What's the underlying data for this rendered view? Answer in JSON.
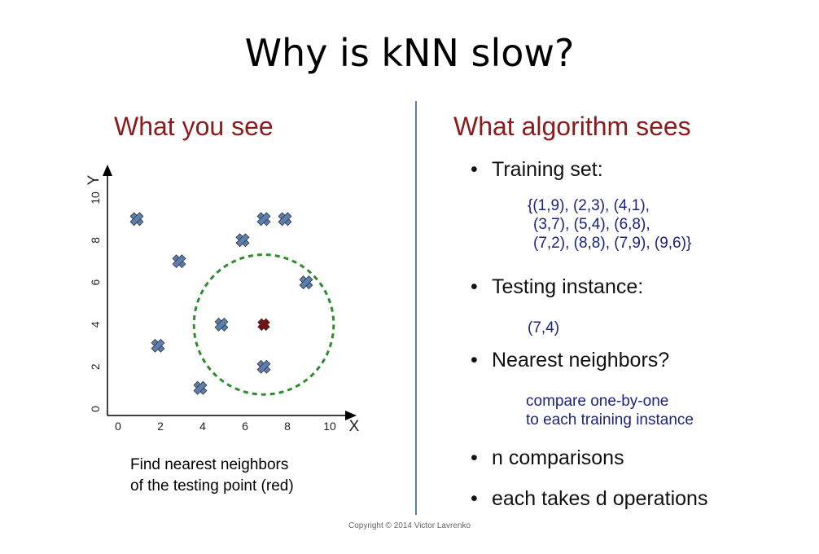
{
  "title": "Why is kNN slow?",
  "left": {
    "heading": "What you see",
    "caption_lines": [
      "Find nearest neighbors",
      "of the testing point (red)"
    ]
  },
  "right": {
    "heading": "What algorithm sees",
    "bullets": [
      "Training set:",
      "Testing instance:",
      "Nearest neighbors?",
      "n comparisons",
      "each takes d operations"
    ],
    "training_set_lines": [
      "{(1,9), (2,3), (4,1),",
      "(3,7), (5,4), (6,8),",
      "(7,2), (8,8), (7,9), (9,6)}"
    ],
    "testing_instance": "(7,4)",
    "nn_lines": [
      "compare one-by-one",
      "to each training instance"
    ]
  },
  "copyright": "Copyright © 2014 Victor Lavrenko",
  "colors": {
    "heading": "#8b1a1a",
    "training_point": "#5b7fb0",
    "test_point": "#7a0f0f",
    "circle": "#2e8b2e",
    "sub_text": "#1a237e"
  },
  "chart_data": {
    "type": "scatter",
    "xlabel": "X",
    "ylabel": "Y",
    "xlim": [
      0,
      10
    ],
    "ylim": [
      0,
      10
    ],
    "xticks": [
      "0",
      "2",
      "4",
      "6",
      "8",
      "10"
    ],
    "yticks": [
      "0",
      "2",
      "4",
      "6",
      "8",
      "10"
    ],
    "grid": false,
    "training_points": [
      {
        "x": 1,
        "y": 9
      },
      {
        "x": 2,
        "y": 3
      },
      {
        "x": 4,
        "y": 1
      },
      {
        "x": 3,
        "y": 7
      },
      {
        "x": 5,
        "y": 4
      },
      {
        "x": 6,
        "y": 8
      },
      {
        "x": 7,
        "y": 2
      },
      {
        "x": 8,
        "y": 9
      },
      {
        "x": 7,
        "y": 9
      },
      {
        "x": 9,
        "y": 6
      }
    ],
    "test_point": {
      "x": 7,
      "y": 4
    },
    "neighborhood_radius": 3.3
  }
}
